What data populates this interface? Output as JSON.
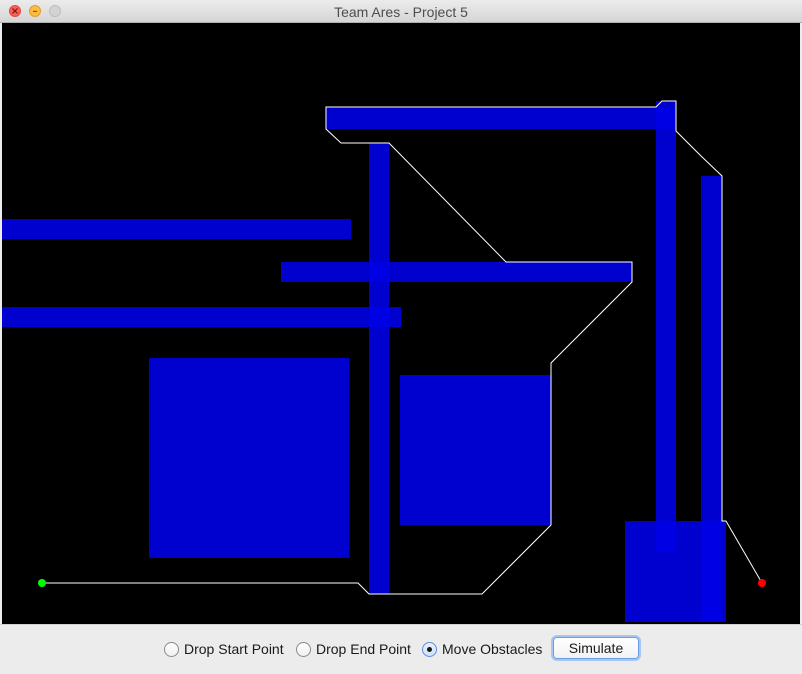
{
  "window": {
    "title": "Team Ares - Project 5",
    "close_glyph": "×",
    "min_glyph": "–"
  },
  "controls": {
    "drop_start_label": "Drop Start Point",
    "drop_end_label": "Drop End Point",
    "move_obstacles_label": "Move Obstacles",
    "selected_mode": "Move Obstacles",
    "simulate_label": "Simulate"
  },
  "colors": {
    "canvas_background": "#000000",
    "obstacle": "#0000e6",
    "path": "#ffffff",
    "start_point": "#00ff00",
    "end_point": "#ff0000"
  }
}
